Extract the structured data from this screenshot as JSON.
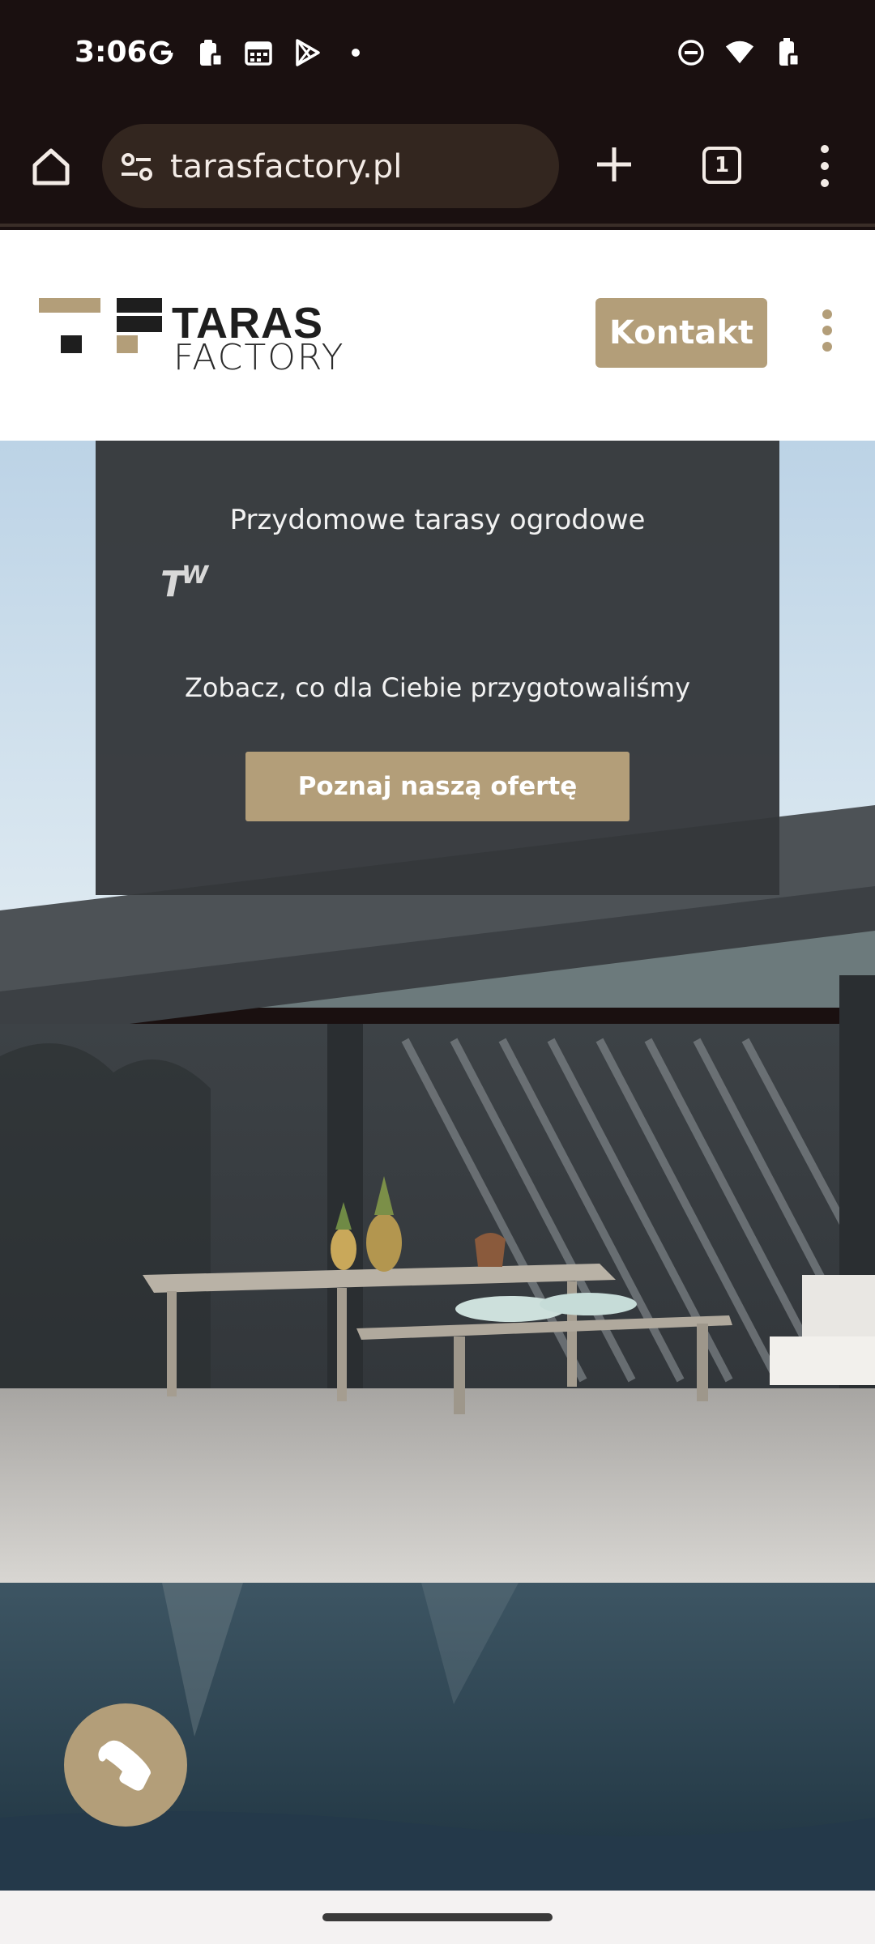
{
  "status_bar": {
    "time": "3:06",
    "left_icons": [
      "google-g-icon",
      "clipboard-icon",
      "calendar-icon",
      "play-store-icon",
      "dot-icon"
    ],
    "right_icons": [
      "do-not-disturb-icon",
      "wifi-icon",
      "battery-icon"
    ]
  },
  "browser": {
    "url": "tarasfactory.pl",
    "tab_count": "1"
  },
  "site": {
    "logo_line1": "TARAS",
    "logo_line2": "FACTORY",
    "contact_label": "Kontakt",
    "brand_color": "#b39e79"
  },
  "hero": {
    "title": "Przydomowe tarasy ogrodowe",
    "tw_t": "T",
    "tw_w": "W",
    "subtitle": "Zobacz, co dla Ciebie przygotowaliśmy",
    "cta_label": "Poznaj naszą ofertę"
  }
}
